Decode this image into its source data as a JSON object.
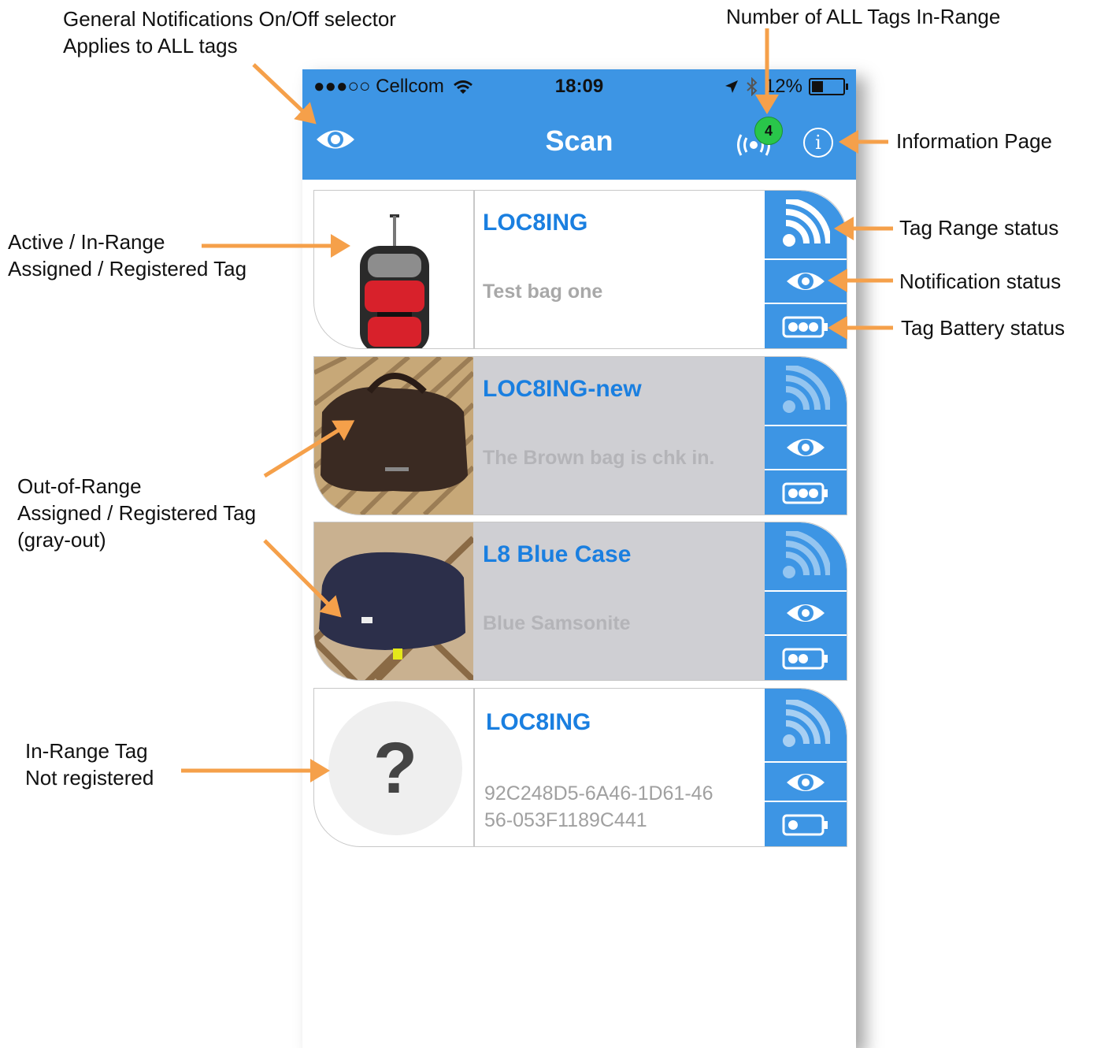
{
  "annotations": {
    "general_notifications": [
      "General Notifications On/Off selector",
      "Applies to ALL tags"
    ],
    "tags_in_range": "Number of ALL Tags In-Range",
    "information_page": "Information Page",
    "active_tag": [
      "Active / In-Range",
      "Assigned / Registered Tag"
    ],
    "tag_range_status": "Tag Range status",
    "notification_status": "Notification status",
    "tag_battery_status": "Tag Battery status",
    "out_of_range": [
      "Out-of-Range",
      "Assigned / Registered Tag",
      "(gray-out)"
    ],
    "not_registered": [
      "In-Range Tag",
      "Not registered"
    ]
  },
  "status_bar": {
    "carrier": "●●●○○ Cellcom",
    "time": "18:09",
    "battery": "12%"
  },
  "nav": {
    "title": "Scan",
    "in_range_count": "4",
    "info_glyph": "i"
  },
  "tags": [
    {
      "title": "LOC8ING",
      "desc": "Test bag one",
      "state": "active",
      "battery_dots": 3
    },
    {
      "title": "LOC8ING-new",
      "desc": "The Brown bag is chk in.",
      "state": "out-of-range",
      "battery_dots": 3
    },
    {
      "title": "L8 Blue Case",
      "desc": "Blue Samsonite",
      "state": "out-of-range",
      "battery_dots": 2
    },
    {
      "title": "LOC8ING",
      "uuid": [
        "92C248D5-6A46-1D61-46",
        "56-053F1189C441"
      ],
      "thumb_glyph": "?",
      "state": "unregistered",
      "battery_dots": 1
    }
  ],
  "colors": {
    "accent": "#3d95e4",
    "title_blue": "#1a7fe0",
    "arrow": "#f5a04a",
    "badge_green": "#29c64a"
  }
}
